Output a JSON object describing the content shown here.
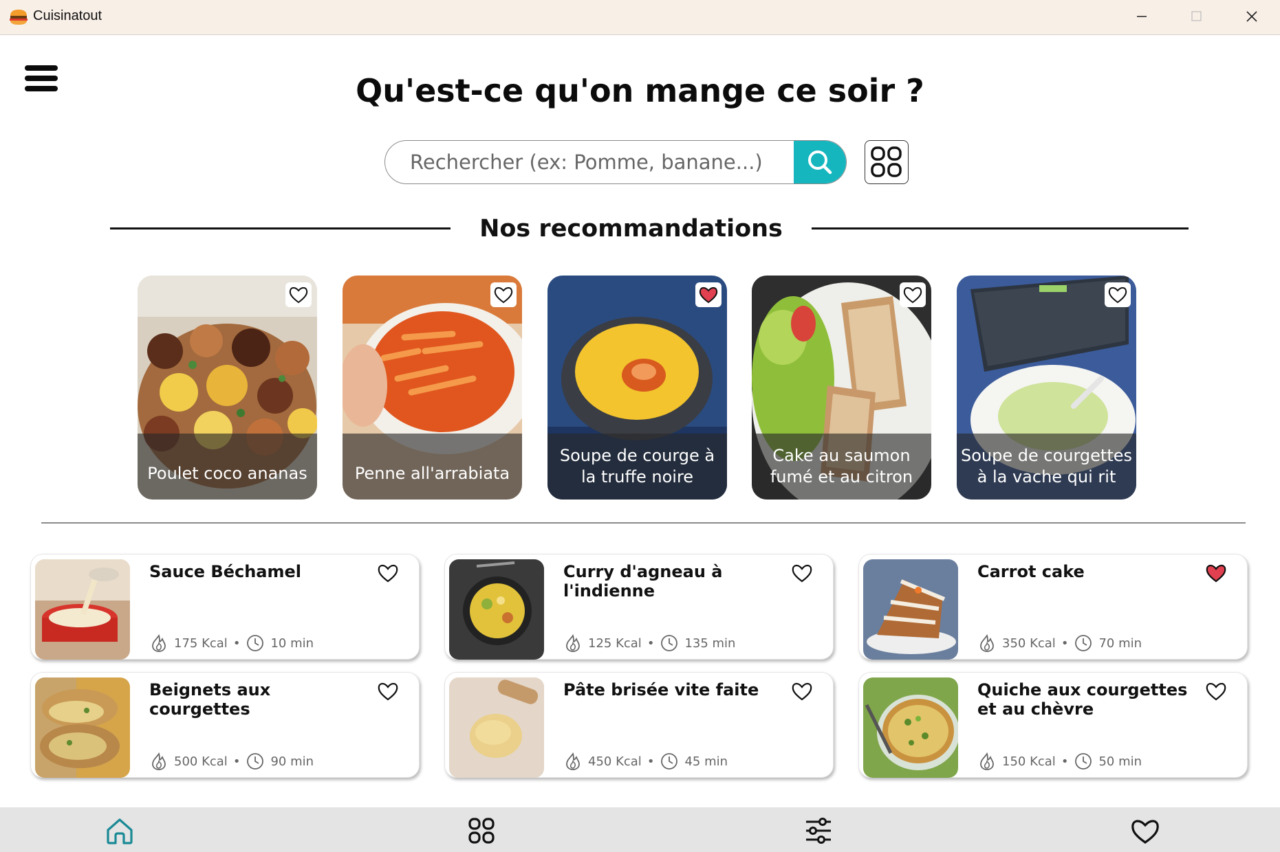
{
  "window": {
    "title": "Cuisinatout"
  },
  "header": {
    "title": "Qu'est-ce qu'on mange ce soir ?",
    "search_placeholder": "Rechercher (ex: Pomme, banane...)"
  },
  "recommendations": {
    "title": "Nos recommandations",
    "items": [
      {
        "name": "Poulet coco ananas",
        "favorite": false
      },
      {
        "name": "Penne all'arrabiata",
        "favorite": false
      },
      {
        "name": "Soupe de courge à la truffe noire",
        "favorite": true
      },
      {
        "name": "Cake au saumon fumé et au citron",
        "favorite": false
      },
      {
        "name": "Soupe de courgettes à la vache qui rit",
        "favorite": false
      }
    ]
  },
  "recipes": [
    {
      "name": "Sauce Béchamel",
      "kcal": "175 Kcal",
      "time": "10 min",
      "favorite": false
    },
    {
      "name": "Curry d'agneau à l'indienne",
      "kcal": "125 Kcal",
      "time": "135 min",
      "favorite": false
    },
    {
      "name": "Carrot cake",
      "kcal": "350 Kcal",
      "time": "70 min",
      "favorite": true
    },
    {
      "name": "Beignets aux courgettes",
      "kcal": "500 Kcal",
      "time": "90 min",
      "favorite": false
    },
    {
      "name": "Pâte brisée vite faite",
      "kcal": "450 Kcal",
      "time": "45 min",
      "favorite": false
    },
    {
      "name": "Quiche aux courgettes et au chèvre",
      "kcal": "150 Kcal",
      "time": "50 min",
      "favorite": false
    }
  ],
  "meta_separator": "•",
  "colors": {
    "accent": "#16b6bf",
    "favorite": "#e0404f",
    "nav_active": "#1a8a95"
  },
  "nav": [
    "home-icon",
    "grid-icon",
    "sliders-icon",
    "heart-icon"
  ]
}
